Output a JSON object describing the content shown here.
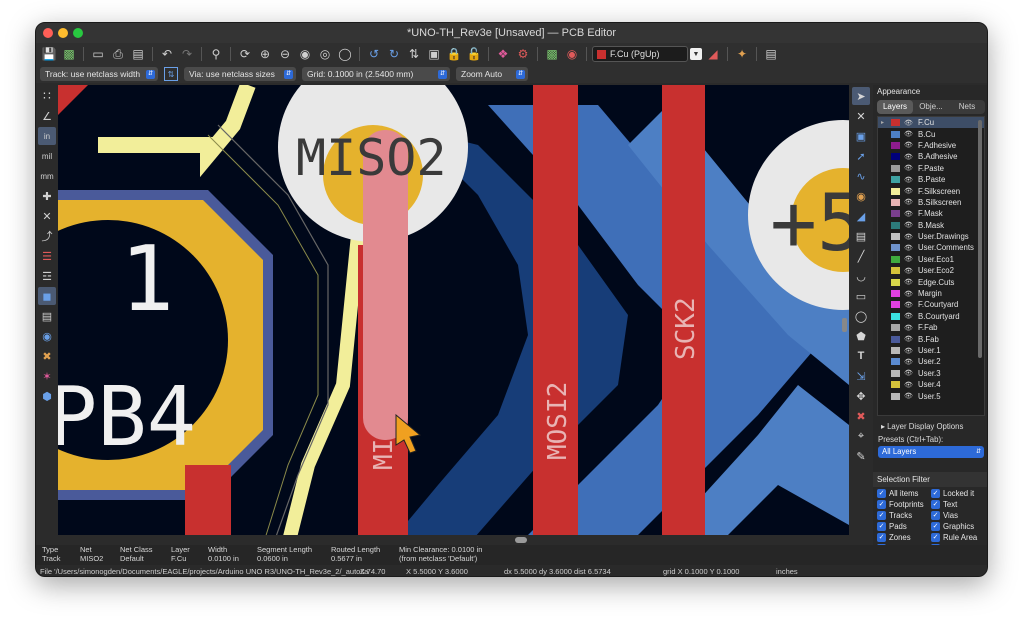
{
  "window": {
    "title": "*UNO-TH_Rev3e [Unsaved] — PCB Editor"
  },
  "colors": {
    "close": "#ff5f57",
    "minimize": "#febc2e",
    "maximize": "#28c840",
    "accent": "#2d6ad8",
    "fcu": "#c8302f",
    "bcu": "#4d7fc4",
    "silk": "#f2ee9a",
    "courtyard_text": "#e8e8e8"
  },
  "toolbar": {
    "active_layer": "F.Cu (PgUp)"
  },
  "options": {
    "track_width": "Track: use netclass width",
    "via_size": "Via: use netclass sizes",
    "grid": "Grid: 0.1000 in (2.5400 mm)",
    "zoom": "Zoom Auto"
  },
  "left_toolbar": {
    "inch_label": "in",
    "mil_label": "mil",
    "mm_label": "mm"
  },
  "canvas": {
    "pad_label_miso2": "MISO2",
    "pad_label_plus5": "+5",
    "pad_number": "1",
    "pad_net_pb4": "PB4",
    "track_label_mosi2": "MOSI2",
    "track_label_sck2": "SCK2",
    "track_label_miso_partial": "MI"
  },
  "appearance": {
    "title": "Appearance",
    "tabs": [
      "Layers",
      "Obje...",
      "Nets"
    ],
    "layers": [
      {
        "name": "F.Cu",
        "color": "#c8302f"
      },
      {
        "name": "B.Cu",
        "color": "#4d7fc4"
      },
      {
        "name": "F.Adhesive",
        "color": "#8e1c8e"
      },
      {
        "name": "B.Adhesive",
        "color": "#00007a"
      },
      {
        "name": "F.Paste",
        "color": "#9c9c9c"
      },
      {
        "name": "B.Paste",
        "color": "#3fa3a3"
      },
      {
        "name": "F.Silkscreen",
        "color": "#f2ee9a"
      },
      {
        "name": "B.Silkscreen",
        "color": "#e8b4b4"
      },
      {
        "name": "F.Mask",
        "color": "#7a3f8e"
      },
      {
        "name": "B.Mask",
        "color": "#2c7a7a"
      },
      {
        "name": "User.Drawings",
        "color": "#c2c2c2"
      },
      {
        "name": "User.Comments",
        "color": "#6f93cc"
      },
      {
        "name": "User.Eco1",
        "color": "#3faa3f"
      },
      {
        "name": "User.Eco2",
        "color": "#d4c23a"
      },
      {
        "name": "Edge.Cuts",
        "color": "#d8d84a"
      },
      {
        "name": "Margin",
        "color": "#e040e0"
      },
      {
        "name": "F.Courtyard",
        "color": "#e040e0"
      },
      {
        "name": "B.Courtyard",
        "color": "#3ae0e0"
      },
      {
        "name": "F.Fab",
        "color": "#a8a8a8"
      },
      {
        "name": "B.Fab",
        "color": "#4a5a9a"
      },
      {
        "name": "User.1",
        "color": "#b8b8b8"
      },
      {
        "name": "User.2",
        "color": "#5a8ad0"
      },
      {
        "name": "User.3",
        "color": "#b8b8b8"
      },
      {
        "name": "User.4",
        "color": "#d4c23a"
      },
      {
        "name": "User.5",
        "color": "#b8b8b8"
      }
    ],
    "layer_display_options": "Layer Display Options",
    "presets_label": "Presets (Ctrl+Tab):",
    "presets_value": "All Layers"
  },
  "selection_filter": {
    "title": "Selection Filter",
    "items": [
      "All items",
      "Locked it",
      "Footprints",
      "Text",
      "Tracks",
      "Vias",
      "Pads",
      "Graphics",
      "Zones",
      "Rule Area",
      "Dimensions",
      "Other ite"
    ]
  },
  "message_panel": {
    "columns": [
      {
        "header": "Type",
        "value": "Track"
      },
      {
        "header": "Net",
        "value": "MISO2"
      },
      {
        "header": "Net Class",
        "value": "Default"
      },
      {
        "header": "Layer",
        "value": "F.Cu"
      },
      {
        "header": "Width",
        "value": "0.0100 in"
      },
      {
        "header": "Segment Length",
        "value": "0.0600 in"
      },
      {
        "header": "Routed Length",
        "value": "0.5677 in"
      },
      {
        "header": "Min Clearance: 0.0100 in",
        "value": "(from netclass 'Default')"
      }
    ]
  },
  "status": {
    "file": "File '/Users/simonogden/Documents/EAGLE/projects/Arduino UNO R3/UNO-TH_Rev3e_2/_autosa",
    "zoom": "Z 74.70",
    "xy": "X 5.5000  Y 3.6000",
    "delta": "dx 5.5000  dy 3.6000  dist 6.5734",
    "grid": "grid X 0.1000  Y 0.1000",
    "units": "inches"
  }
}
